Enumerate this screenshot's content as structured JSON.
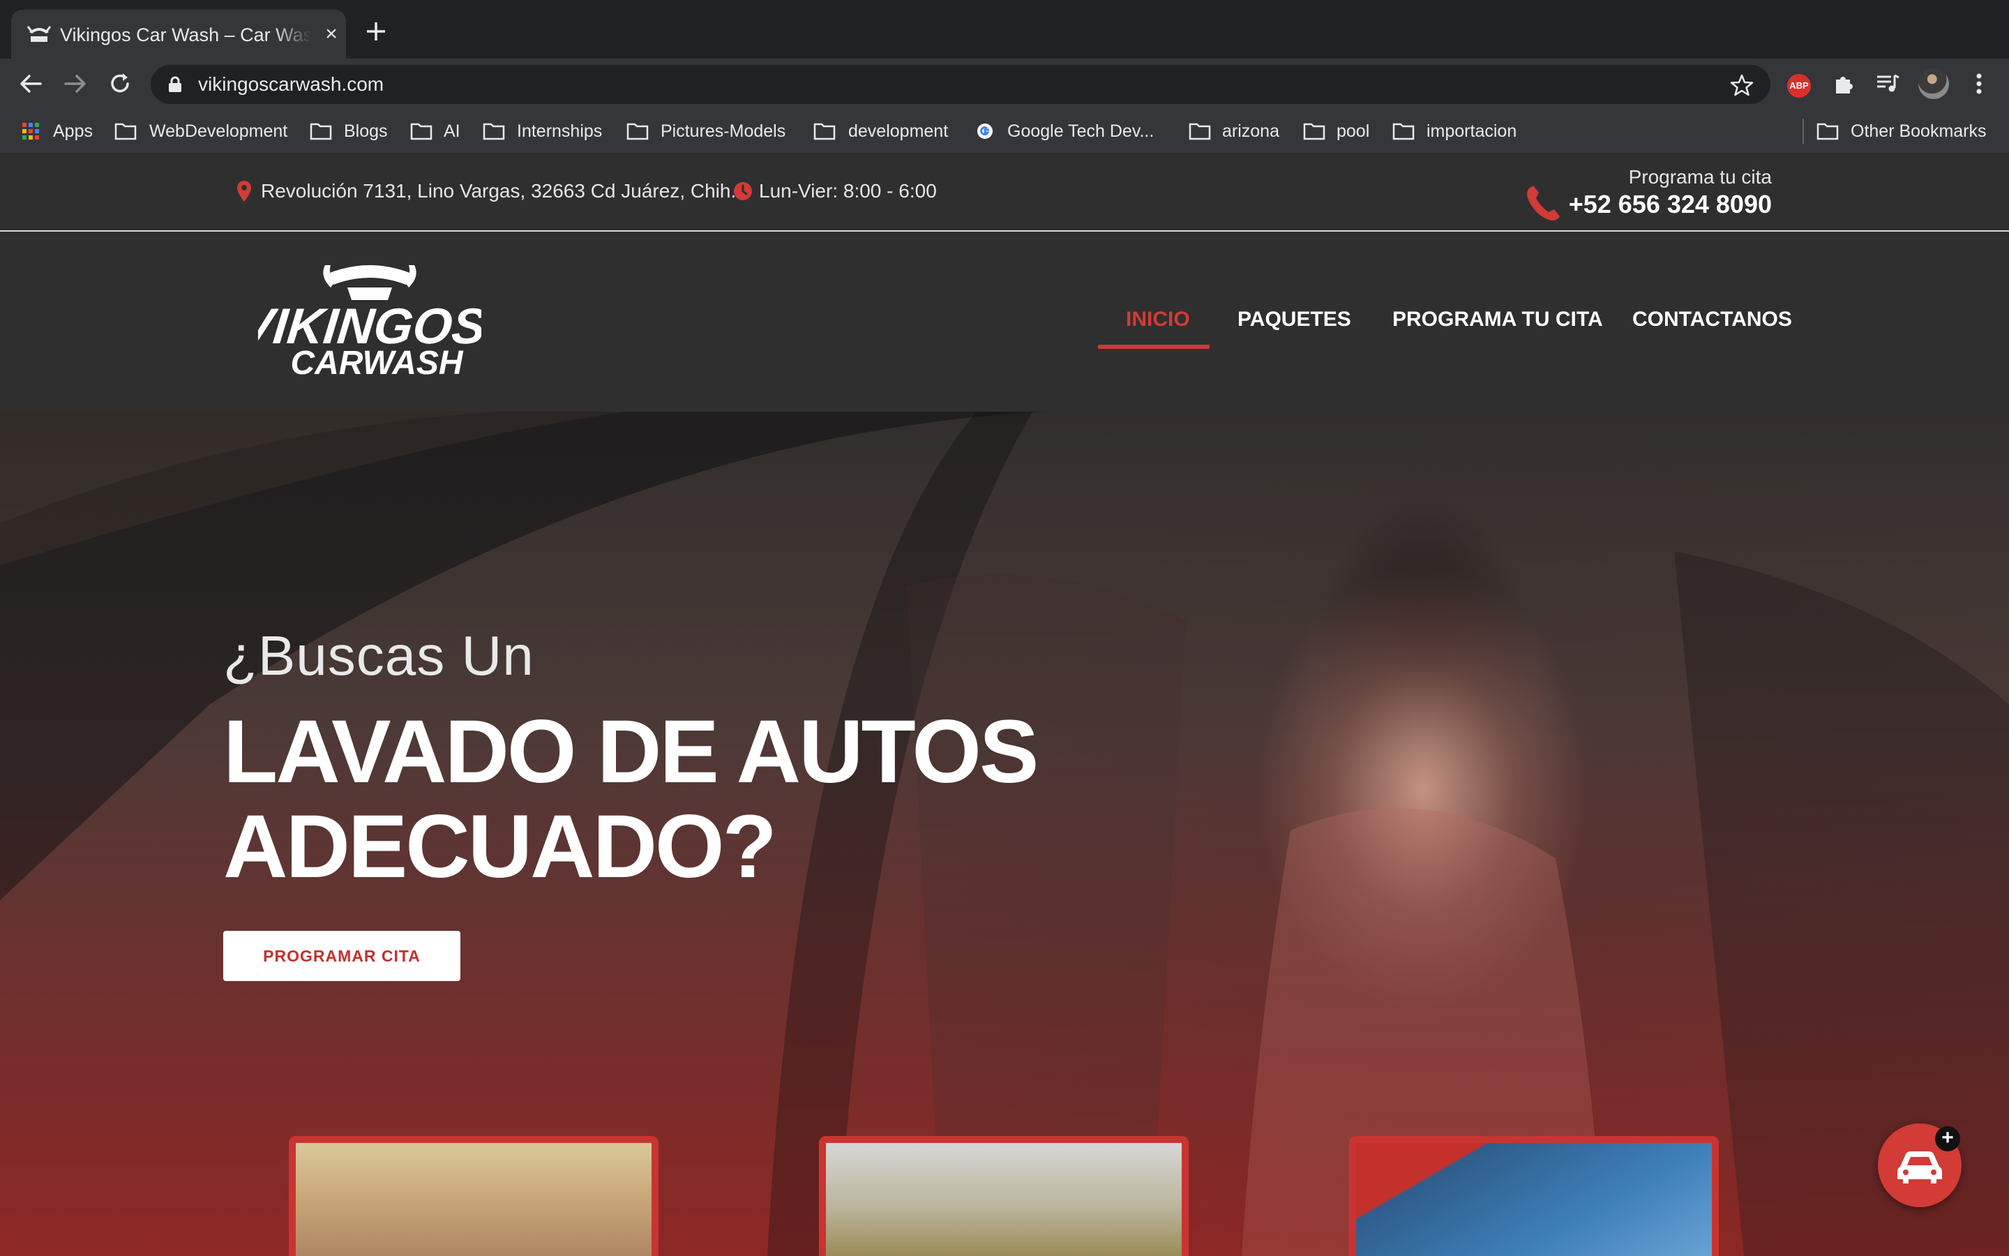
{
  "browser": {
    "tab_title": "Vikingos Car Wash – Car Wash",
    "tab_close": "×",
    "url": "vikingoscarwash.com",
    "abp_label": "ABP"
  },
  "bookmarks": [
    {
      "label": "Apps",
      "icon": "apps-grid-icon"
    },
    {
      "label": "WebDevelopment",
      "icon": "folder-icon"
    },
    {
      "label": "Blogs",
      "icon": "folder-icon"
    },
    {
      "label": "AI",
      "icon": "folder-icon"
    },
    {
      "label": "Internships",
      "icon": "folder-icon"
    },
    {
      "label": "Pictures-Models",
      "icon": "folder-icon"
    },
    {
      "label": "development",
      "icon": "folder-icon"
    },
    {
      "label": "Google Tech Dev...",
      "icon": "google-icon"
    },
    {
      "label": "arizona",
      "icon": "folder-icon"
    },
    {
      "label": "pool",
      "icon": "folder-icon"
    },
    {
      "label": "importacion",
      "icon": "folder-icon"
    },
    {
      "label": "Other Bookmarks",
      "icon": "folder-icon"
    }
  ],
  "site": {
    "topbar": {
      "address": "Revolución 7131, Lino Vargas, 32663 Cd Juárez, Chih.",
      "hours": "Lun-Vier: 8:00 - 6:00",
      "cta_label": "Programa tu cita",
      "phone": "+52 656 324 8090"
    },
    "logo_text": [
      "VIKINGOS",
      "CARWASH"
    ],
    "nav": [
      "INICIO",
      "PAQUETES",
      "PROGRAMA TU CITA",
      "CONTACTANOS"
    ],
    "hero": {
      "subheading": "¿Buscas Un",
      "heading_line1": "LAVADO DE AUTOS",
      "heading_line2": "ADECUADO?",
      "button": "PROGRAMAR CITA"
    },
    "float_plus": "+"
  },
  "colors": {
    "accent": "#d23b36",
    "header_bg": "#2f2f2f",
    "chrome_bg": "#35363a"
  }
}
